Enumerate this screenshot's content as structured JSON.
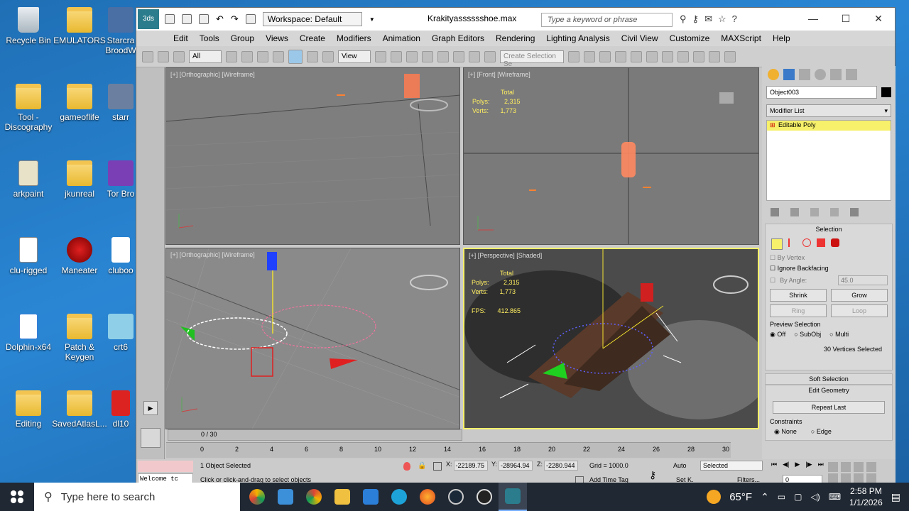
{
  "desktop": {
    "icons": [
      {
        "label": "Recycle Bin",
        "type": "recycle"
      },
      {
        "label": "EMULATORS",
        "type": "folder"
      },
      {
        "label": "Starcra BroodW",
        "type": "app"
      },
      {
        "label": "Tool - Discography",
        "type": "folder"
      },
      {
        "label": "gameoflife",
        "type": "folder"
      },
      {
        "label": "starr",
        "type": "app"
      },
      {
        "label": "arkpaint",
        "type": "app"
      },
      {
        "label": "jkunreal",
        "type": "folder"
      },
      {
        "label": "Tor Bro",
        "type": "app"
      },
      {
        "label": "clu-rigged",
        "type": "file"
      },
      {
        "label": "Maneater",
        "type": "app"
      },
      {
        "label": "cluboo",
        "type": "file"
      },
      {
        "label": "Dolphin-x64",
        "type": "app"
      },
      {
        "label": "Patch & Keygen",
        "type": "folder"
      },
      {
        "label": "crt6",
        "type": "app"
      },
      {
        "label": "Editing",
        "type": "folder"
      },
      {
        "label": "SavedAtlasL...",
        "type": "folder"
      },
      {
        "label": "dl10",
        "type": "file"
      }
    ]
  },
  "app": {
    "title": "Krakityasssssshoe.max",
    "workspace": "Workspace: Default",
    "search_placeholder": "Type a keyword or phrase",
    "menu": [
      "Edit",
      "Tools",
      "Group",
      "Views",
      "Create",
      "Modifiers",
      "Animation",
      "Graph Editors",
      "Rendering",
      "Lighting Analysis",
      "Civil View",
      "Customize",
      "MAXScript",
      "Help"
    ],
    "toolbar": {
      "filter": "All",
      "ref_coord": "View",
      "selection_set": "Create Selection Se"
    },
    "viewports": {
      "top_left": "[+] [Orthographic] [Wireframe]",
      "top_right": "[+] [Front] [Wireframe]",
      "bottom_left": "[+] [Orthographic] [Wireframe]",
      "bottom_right": "[+] [Perspective] [Shaded]"
    },
    "stats": {
      "total": "Total",
      "polys_label": "Polys:",
      "polys": "2,315",
      "verts_label": "Verts:",
      "verts": "1,773",
      "fps_label": "FPS:",
      "fps": "412.865",
      "persp_polys": "2,315",
      "persp_verts": "1,773"
    },
    "command_panel": {
      "object_name": "Object003",
      "modifier_list": "Modifier List",
      "stack_item": "Editable Poly",
      "selection_title": "Selection",
      "by_vertex": "By Vertex",
      "ignore_backfacing": "Ignore Backfacing",
      "by_angle": "By Angle:",
      "angle_value": "45.0",
      "shrink": "Shrink",
      "grow": "Grow",
      "ring": "Ring",
      "loop": "Loop",
      "preview_selection": "Preview Selection",
      "preview_off": "Off",
      "preview_subobj": "SubObj",
      "preview_multi": "Multi",
      "vertices_selected": "30 Vertices Selected",
      "soft_selection": "Soft Selection",
      "edit_geometry": "Edit Geometry",
      "repeat_last": "Repeat Last",
      "constraints": "Constraints",
      "constraint_none": "None",
      "constraint_edge": "Edge"
    },
    "timeline": {
      "frame": "0 / 30",
      "ticks": [
        "0",
        "2",
        "4",
        "6",
        "8",
        "10",
        "12",
        "14",
        "16",
        "18",
        "20",
        "22",
        "24",
        "26",
        "28",
        "30"
      ]
    },
    "status": {
      "maxscript": "Welcome tc",
      "objects_selected": "1 Object Selected",
      "prompt": "Click or click-and-drag to select objects",
      "x_label": "X:",
      "x": "-22189.75",
      "y_label": "Y:",
      "y": "-28964.94",
      "z_label": "Z:",
      "z": "-2280.944",
      "grid": "Grid = 1000.0",
      "add_time_tag": "Add Time Tag",
      "auto": "Auto",
      "set_k": "Set K.",
      "key_filter": "Selected",
      "filters": "Filters...",
      "current_frame": "0"
    }
  },
  "taskbar": {
    "search_placeholder": "Type here to search",
    "weather": "65°F",
    "time": "2:58 PM",
    "date": "1/1/2026"
  },
  "colors": {
    "accent_yellow": "#f6f06a",
    "selection_red": "#ff3030",
    "taskbar": "#202833"
  }
}
